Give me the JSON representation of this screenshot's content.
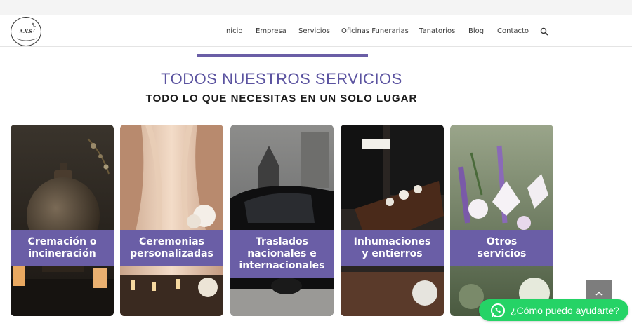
{
  "brand": {
    "logo_text": "A.V.S"
  },
  "nav": {
    "items": [
      {
        "label": "Inicio"
      },
      {
        "label": "Empresa"
      },
      {
        "label": "Servicios"
      },
      {
        "label": "Oficinas Funerarias"
      },
      {
        "label": "Tanatorios"
      },
      {
        "label": "Blog"
      },
      {
        "label": "Contacto"
      }
    ],
    "search_icon": "search-icon"
  },
  "section": {
    "title": "TODOS NUESTROS SERVICIOS",
    "subtitle": "TODO LO QUE NECESITAS EN UN SOLO LUGAR"
  },
  "services": [
    {
      "lines": [
        "Cremación o",
        "incineración"
      ],
      "image": "cremation-urn"
    },
    {
      "lines": [
        "Ceremonias",
        "personalizadas"
      ],
      "image": "ceremony-curtains"
    },
    {
      "lines": [
        "Traslados",
        "nacionales e",
        "internacionales"
      ],
      "image": "hearse"
    },
    {
      "lines": [
        "Inhumaciones",
        "y entierros"
      ],
      "image": "burial-coffin"
    },
    {
      "lines": [
        "Otros",
        "servicios"
      ],
      "image": "flowers"
    }
  ],
  "colors": {
    "accent": "#6a5ea6",
    "whatsapp": "#25d366"
  },
  "whatsapp": {
    "label": "¿Cómo puedo ayudarte?",
    "icon": "whatsapp-icon"
  },
  "scroll_top": {
    "icon": "chevron-up-icon"
  }
}
